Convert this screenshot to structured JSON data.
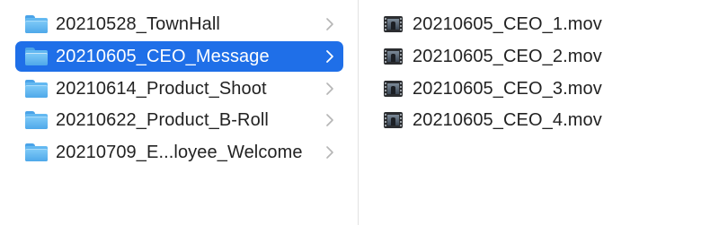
{
  "folders_column": {
    "items": [
      {
        "label": "20210528_TownHall",
        "selected": false
      },
      {
        "label": "20210605_CEO_Message",
        "selected": true
      },
      {
        "label": "20210614_Product_Shoot",
        "selected": false
      },
      {
        "label": "20210622_Product_B-Roll",
        "selected": false
      },
      {
        "label": "20210709_E...loyee_Welcome",
        "selected": false
      }
    ]
  },
  "files_column": {
    "items": [
      {
        "label": "20210605_CEO_1.mov"
      },
      {
        "label": "20210605_CEO_2.mov"
      },
      {
        "label": "20210605_CEO_3.mov"
      },
      {
        "label": "20210605_CEO_4.mov"
      }
    ]
  },
  "colors": {
    "selection": "#1f6fe8",
    "folder": "#4ea8ea",
    "text": "#222222",
    "divider": "#e2e2e2"
  },
  "icons": {
    "folder": "folder-icon",
    "movie": "movie-file-icon",
    "disclosure": "chevron-right-icon"
  }
}
